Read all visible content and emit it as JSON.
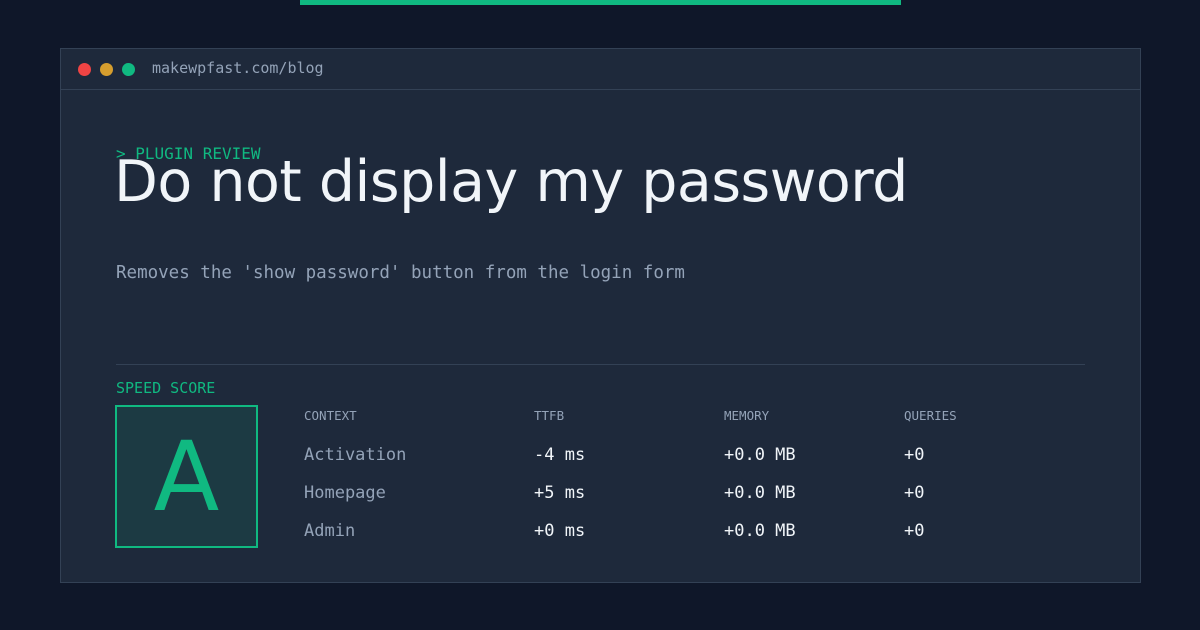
{
  "colors": {
    "background": "#0f1729",
    "panel": "#1e293b",
    "accent": "#10b981",
    "dot_red": "#ef4444",
    "dot_yellow": "#d69e2e",
    "dot_green": "#10b981"
  },
  "window": {
    "url": "makewpfast.com/blog"
  },
  "hero": {
    "kicker": "> PLUGIN REVIEW",
    "title": "Do not display my password",
    "subtitle": "Removes the 'show password' button from the login form"
  },
  "score": {
    "label": "SPEED SCORE",
    "grade": "A"
  },
  "table": {
    "headers": [
      "CONTEXT",
      "TTFB",
      "MEMORY",
      "QUERIES"
    ],
    "rows": [
      [
        "Activation",
        "-4 ms",
        "+0.0 MB",
        "+0"
      ],
      [
        "Homepage",
        "+5 ms",
        "+0.0 MB",
        "+0"
      ],
      [
        "Admin",
        "+0 ms",
        "+0.0 MB",
        "+0"
      ]
    ]
  }
}
